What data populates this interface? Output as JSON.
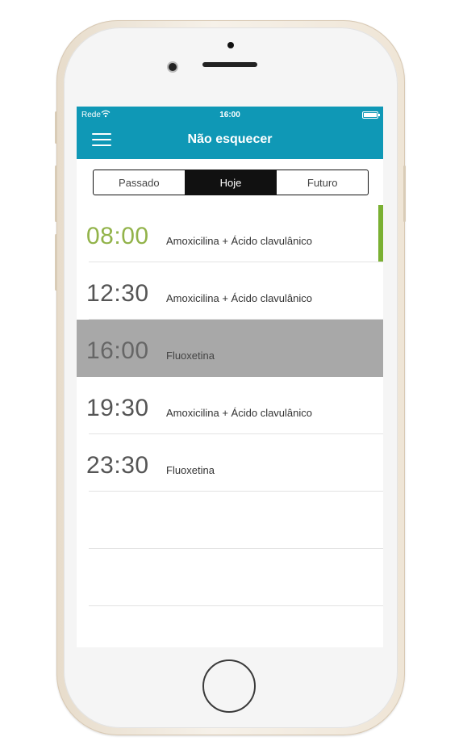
{
  "status_bar": {
    "carrier": "Rede",
    "time": "16:00"
  },
  "nav": {
    "title": "Não esquecer"
  },
  "segments": [
    {
      "label": "Passado",
      "active": false
    },
    {
      "label": "Hoje",
      "active": true
    },
    {
      "label": "Futuro",
      "active": false
    }
  ],
  "doses": [
    {
      "time": "08:00",
      "medication": "Amoxicilina + Ácido clavulânico",
      "state": "upcoming"
    },
    {
      "time": "12:30",
      "medication": "Amoxicilina + Ácido clavulânico",
      "state": "normal"
    },
    {
      "time": "16:00",
      "medication": "Fluoxetina",
      "state": "selected"
    },
    {
      "time": "19:30",
      "medication": "Amoxicilina + Ácido clavulânico",
      "state": "normal"
    },
    {
      "time": "23:30",
      "medication": "Fluoxetina",
      "state": "normal"
    }
  ],
  "colors": {
    "header": "#0f98b6",
    "accent_green": "#7ab032",
    "time_green": "#92b34a",
    "selected_row": "#a8a8a8"
  },
  "icons": [
    "wifi-icon",
    "battery-icon",
    "menu-icon",
    "home-button"
  ]
}
